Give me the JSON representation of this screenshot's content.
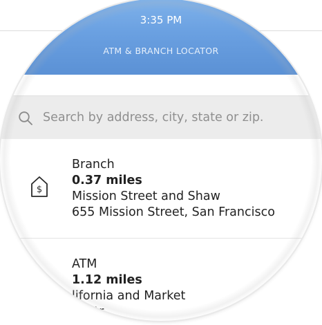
{
  "status_bar": {
    "time": "3:35 PM"
  },
  "header": {
    "title": "ATM & BRANCH LOCATOR"
  },
  "search": {
    "placeholder": "Search by address, city, state or zip.",
    "value": ""
  },
  "results": [
    {
      "type": "Branch",
      "distance": "0.37 miles",
      "name": "Mission Street and Shaw",
      "address": "655 Mission Street, San Francisco",
      "icon": "branch-dollar-icon"
    },
    {
      "type": "ATM",
      "distance": "1.12 miles",
      "name": "lifornia and Market",
      "address": "ia Str"
    }
  ],
  "colors": {
    "header_top": "#7fb2ea",
    "header_bottom": "#5b91d5",
    "search_bg": "#ececec",
    "text": "#222222",
    "placeholder": "#8f8f8f"
  }
}
